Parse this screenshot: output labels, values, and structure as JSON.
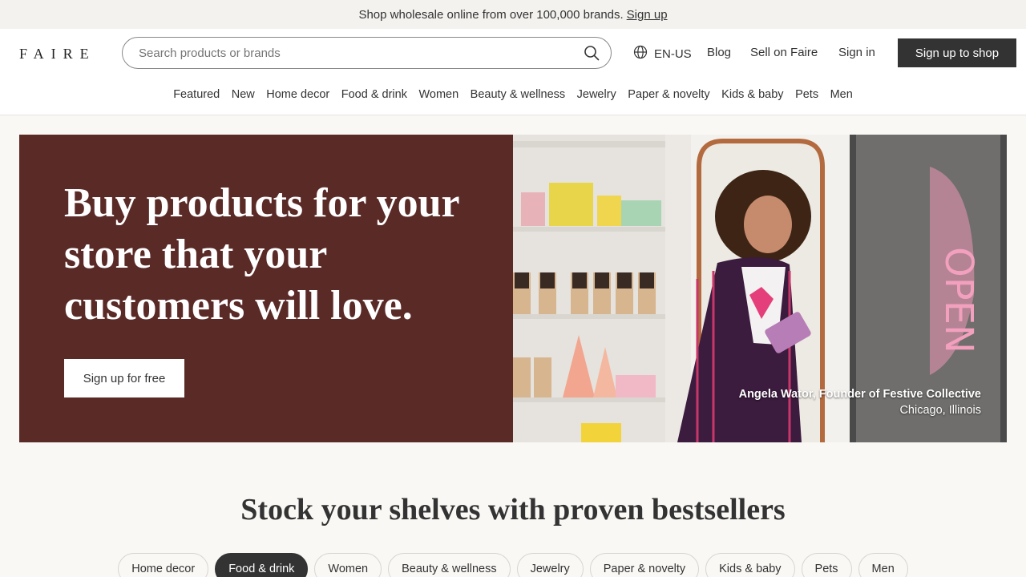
{
  "announcement": {
    "text": "Shop wholesale online from over 100,000 brands.",
    "link": "Sign up"
  },
  "header": {
    "logo": "FAIRE",
    "search_placeholder": "Search products or brands",
    "lang": "EN-US",
    "blog": "Blog",
    "sell": "Sell on Faire",
    "signin": "Sign in",
    "signup": "Sign up to shop"
  },
  "categories": [
    "Featured",
    "New",
    "Home decor",
    "Food & drink",
    "Women",
    "Beauty & wellness",
    "Jewelry",
    "Paper & novelty",
    "Kids & baby",
    "Pets",
    "Men"
  ],
  "hero": {
    "title": "Buy products for your store that your customers will love.",
    "button": "Sign up for free",
    "caption_name": "Angela Wator, Founder of Festive Collective",
    "caption_location": "Chicago, Illinois"
  },
  "bestsellers": {
    "title": "Stock your shelves with proven bestsellers",
    "pills": [
      "Home decor",
      "Food & drink",
      "Women",
      "Beauty & wellness",
      "Jewelry",
      "Paper & novelty",
      "Kids & baby",
      "Pets",
      "Men"
    ],
    "active": "Food & drink"
  },
  "colors": {
    "hero_bg": "#5a2a27",
    "dark": "#333333",
    "page_bg": "#faf8f5"
  },
  "icons": [
    "search-icon",
    "globe-icon"
  ]
}
